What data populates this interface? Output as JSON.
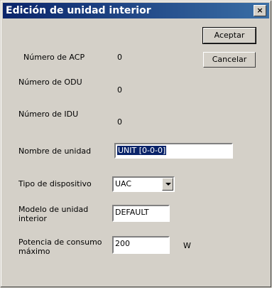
{
  "window": {
    "title": "Edición de unidad interior",
    "close_glyph": "×"
  },
  "buttons": {
    "accept": "Aceptar",
    "cancel": "Cancelar"
  },
  "fields": {
    "acp_label": "Número de ACP",
    "acp_value": "0",
    "odu_label": "Número de ODU",
    "odu_value": "0",
    "idu_label": "Número de IDU",
    "idu_value": "0",
    "unit_name_label": "Nombre de unidad",
    "unit_name_value": "UNIT [0-0-0]",
    "device_type_label": "Tipo de dispositivo",
    "device_type_value": "UAC",
    "indoor_model_label": "Modelo de unidad interior",
    "indoor_model_value": "DEFAULT",
    "max_power_label": "Potencia de  consumo máximo",
    "max_power_value": "200",
    "max_power_unit": "W"
  }
}
